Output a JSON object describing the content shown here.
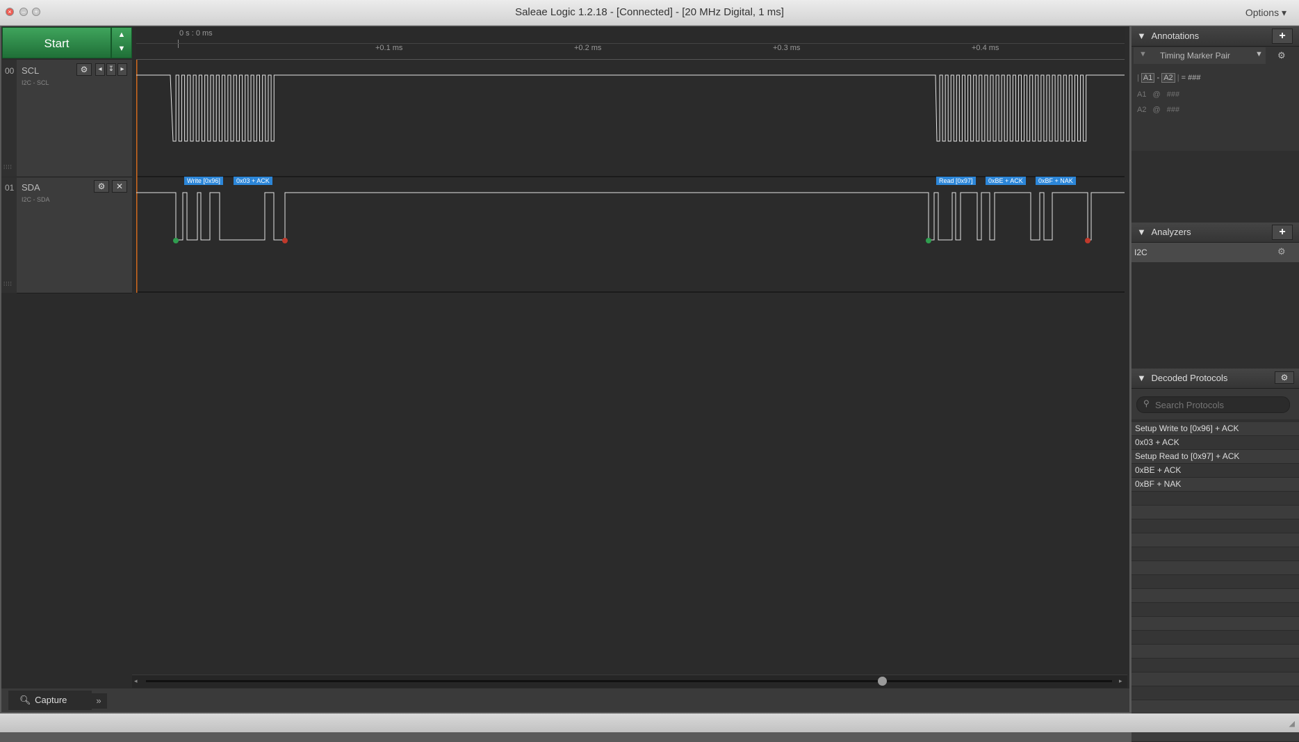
{
  "window": {
    "title": "Saleae Logic 1.2.18 - [Connected] - [20 MHz Digital, 1 ms]",
    "options_label": "Options ▾"
  },
  "toolbar": {
    "start_label": "Start"
  },
  "timeline": {
    "origin_label": "0 s : 0 ms",
    "ticks": [
      "+0.1 ms",
      "+0.2 ms",
      "+0.3 ms",
      "+0.4 ms"
    ]
  },
  "channels": [
    {
      "number": "00",
      "name": "SCL",
      "subtitle": "I2C - SCL"
    },
    {
      "number": "01",
      "name": "SDA",
      "subtitle": "I2C - SDA"
    }
  ],
  "decode_tags": [
    "Write [0x96]",
    "0x03 + ACK",
    "Read [0x97]",
    "0xBE + ACK",
    "0xBF + NAK"
  ],
  "bottom": {
    "capture_tab": "Capture"
  },
  "annotations": {
    "title": "Annotations",
    "marker_pair": "Timing Marker Pair",
    "formula": {
      "a1": "A1",
      "dash": "-",
      "a2": "A2",
      "equals": "= ###"
    },
    "a1_row": {
      "label": "A1",
      "at": "@",
      "value": "###"
    },
    "a2_row": {
      "label": "A2",
      "at": "@",
      "value": "###"
    }
  },
  "analyzers": {
    "title": "Analyzers",
    "items": [
      "I2C"
    ]
  },
  "decoded": {
    "title": "Decoded Protocols",
    "search_placeholder": "Search Protocols",
    "items": [
      "Setup Write to [0x96] + ACK",
      "0x03 + ACK",
      "Setup Read to [0x97] + ACK",
      "0xBE + ACK",
      "0xBF + NAK"
    ]
  },
  "colors": {
    "start_green": "#2e8b4a",
    "tag_blue": "#2c86d8",
    "wave": "#e6e6e6",
    "start_dot": "#2f9e4f",
    "stop_dot": "#c0392b",
    "trigger_line": "#d2691e"
  }
}
